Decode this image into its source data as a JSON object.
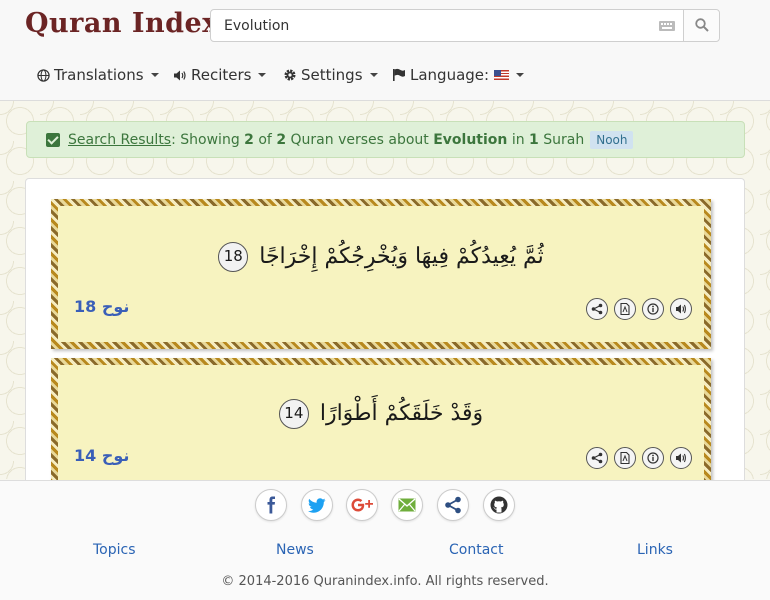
{
  "header": {
    "logo_text": "Quran Index",
    "search": {
      "value": "Evolution",
      "placeholder": ""
    },
    "nav": [
      {
        "label": "Translations",
        "icon": "globe-icon"
      },
      {
        "label": "Reciters",
        "icon": "speaker-icon"
      },
      {
        "label": "Settings",
        "icon": "gear-icon"
      },
      {
        "label": "Language:",
        "icon": "flag-icon"
      }
    ]
  },
  "alert": {
    "link_text": "Search Results",
    "text_1": ": Showing ",
    "shown": "2",
    "text_2": " of ",
    "total": "2",
    "text_3": " Quran verses about ",
    "term": "Evolution",
    "text_4": " in ",
    "surah_count": "1",
    "text_5": " Surah",
    "badge": "Nooh"
  },
  "verses": [
    {
      "arabic": "ثُمَّ يُعِيدُكُمْ فِيهَا وَيُخْرِجُكُمْ إِخْرَاجًا",
      "number": "18",
      "reference": "نوح 18"
    },
    {
      "arabic": "وَقَدْ خَلَقَكُمْ أَطْوَارًا",
      "number": "14",
      "reference": "نوح 14"
    }
  ],
  "verse_tools": [
    "share-icon",
    "pdf-icon",
    "info-icon",
    "audio-icon"
  ],
  "footer": {
    "social": [
      "facebook-icon",
      "twitter-icon",
      "google-plus-icon",
      "email-icon",
      "share-icon",
      "github-icon"
    ],
    "links": [
      "Topics",
      "News",
      "Contact",
      "Links"
    ],
    "copyright": "© 2014-2016 Quranindex.info. All rights reserved."
  },
  "colors": {
    "logo": "#6b2424",
    "alert_bg": "#dff0d8",
    "alert_text": "#3c763d",
    "verse_bg": "#f7f3c0",
    "link": "#2a64b4",
    "reference": "#3a5fb8"
  }
}
